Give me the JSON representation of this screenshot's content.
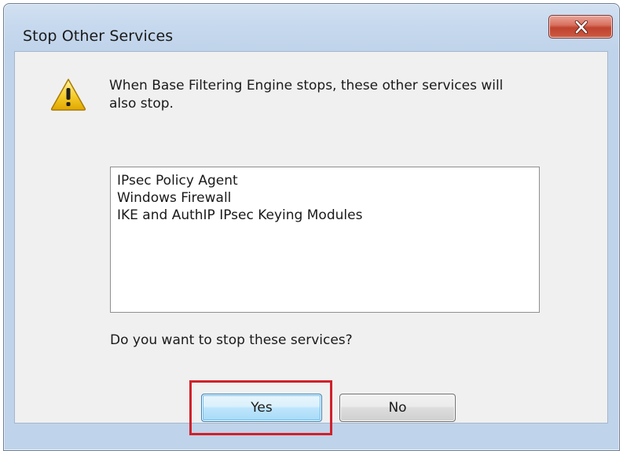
{
  "dialog": {
    "title": "Stop Other Services",
    "message": "When Base Filtering Engine stops, these other services will also stop.",
    "services": [
      "IPsec Policy Agent",
      "Windows Firewall",
      "IKE and AuthIP IPsec Keying Modules"
    ],
    "question": "Do you want to stop these services?",
    "yes_label": "Yes",
    "no_label": "No",
    "icons": {
      "close": "close-icon",
      "warning": "warning-icon"
    },
    "colors": {
      "highlight": "#d1202a",
      "close_button": "#c8503c"
    }
  }
}
